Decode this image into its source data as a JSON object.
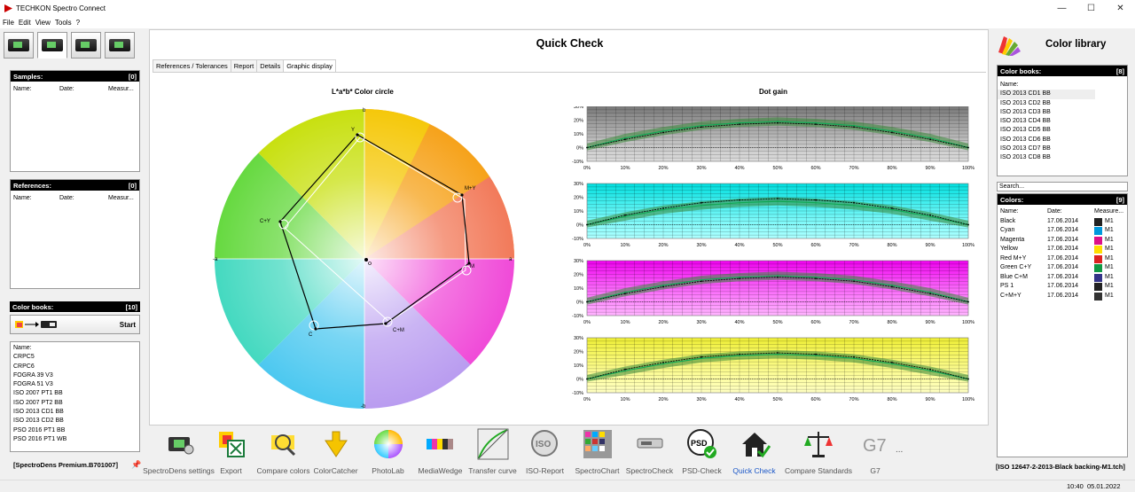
{
  "window": {
    "title": "TECHKON Spectro Connect",
    "min": "—",
    "max": "☐",
    "close": "✕"
  },
  "menu": [
    "File",
    "Edit",
    "View",
    "Tools",
    "?"
  ],
  "left": {
    "samples": {
      "title": "Samples:",
      "count": "[0]",
      "cols": [
        "Name:",
        "Date:",
        "Measur..."
      ]
    },
    "references": {
      "title": "References:",
      "count": "[0]",
      "cols": [
        "Name:",
        "Date:",
        "Measur..."
      ]
    },
    "colorbooks": {
      "title": "Color books:",
      "count": "[10]",
      "start": "Start",
      "col": "Name:",
      "items": [
        "CRPC5",
        "CRPC6",
        "FOGRA 39 V3",
        "FOGRA 51 V3",
        "ISO 2007 PT1 BB",
        "ISO 2007 PT2 BB",
        "ISO 2013 CD1 BB",
        "ISO 2013 CD2 BB",
        "PSO 2016 PT1 BB",
        "PSO 2016 PT1 WB"
      ]
    },
    "serial": "[SpectroDens Premium.B701007]",
    "pin": "📌"
  },
  "center": {
    "title": "Quick Check",
    "tabs": [
      "References / Tolerances",
      "Report",
      "Details",
      "Graphic display"
    ],
    "circle_title": "L*a*b* Color circle",
    "dot_title": "Dot gain",
    "axis_labels": {
      "top": "b",
      "bottom": "-b",
      "left": "-a",
      "right": "a"
    },
    "points": [
      "Y",
      "M+Y",
      "M",
      "C+M",
      "C",
      "C+Y"
    ]
  },
  "chart_data": [
    {
      "type": "line",
      "title": "Dot gain",
      "panel": "Black",
      "x": [
        0,
        10,
        20,
        30,
        40,
        50,
        60,
        70,
        80,
        90,
        100
      ],
      "xlabel": "",
      "ylabel": "",
      "ylim": [
        -10,
        30
      ],
      "yticks": [
        "30%",
        "20%",
        "10%",
        "0%",
        "-10%"
      ],
      "xticks": [
        "0%",
        "10%",
        "20%",
        "30%",
        "40%",
        "50%",
        "60%",
        "70%",
        "80%",
        "90%",
        "100%"
      ],
      "series": [
        {
          "values": [
            0,
            7,
            12,
            16,
            18,
            19,
            18,
            16,
            12,
            7,
            0
          ]
        },
        {
          "values": [
            0,
            6,
            11,
            15,
            17,
            18,
            17,
            15,
            11,
            6,
            0
          ]
        }
      ]
    },
    {
      "type": "line",
      "panel": "Cyan",
      "x": [
        0,
        10,
        20,
        30,
        40,
        50,
        60,
        70,
        80,
        90,
        100
      ],
      "ylim": [
        -10,
        30
      ],
      "series": [
        {
          "values": [
            0,
            6,
            11,
            14,
            16,
            17,
            16,
            14,
            11,
            6,
            0
          ]
        },
        {
          "values": [
            0,
            7,
            12,
            16,
            18,
            19,
            18,
            16,
            12,
            7,
            0
          ]
        }
      ]
    },
    {
      "type": "line",
      "panel": "Magenta",
      "x": [
        0,
        10,
        20,
        30,
        40,
        50,
        60,
        70,
        80,
        90,
        100
      ],
      "ylim": [
        -10,
        30
      ],
      "series": [
        {
          "values": [
            0,
            7,
            12,
            16,
            18,
            19,
            18,
            16,
            12,
            7,
            0
          ]
        },
        {
          "values": [
            0,
            6,
            11,
            15,
            17,
            18,
            17,
            15,
            11,
            6,
            0
          ]
        }
      ]
    },
    {
      "type": "line",
      "panel": "Yellow",
      "x": [
        0,
        10,
        20,
        30,
        40,
        50,
        60,
        70,
        80,
        90,
        100
      ],
      "ylim": [
        -10,
        30
      ],
      "series": [
        {
          "values": [
            0,
            6,
            11,
            15,
            17,
            18,
            17,
            15,
            11,
            6,
            0
          ]
        },
        {
          "values": [
            0,
            7,
            12,
            16,
            18,
            19,
            18,
            16,
            12,
            7,
            0
          ]
        }
      ]
    }
  ],
  "toolbar": [
    "SpectroDens settings",
    "Export",
    "Compare colors",
    "ColorCatcher",
    "PhotoLab",
    "MediaWedge",
    "Transfer curve",
    "ISO-Report",
    "SpectroChart",
    "SpectroCheck",
    "PSD-Check",
    "Quick Check",
    "Compare Standards",
    "G7"
  ],
  "toolbar_more": "...",
  "right": {
    "title": "Color library",
    "books": {
      "title": "Color books:",
      "count": "[8]",
      "col": "Name:",
      "items": [
        "ISO 2013 CD1 BB",
        "ISO 2013 CD2 BB",
        "ISO 2013 CD3 BB",
        "ISO 2013 CD4 BB",
        "ISO 2013 CD5 BB",
        "ISO 2013 CD6 BB",
        "ISO 2013 CD7 BB",
        "ISO 2013 CD8 BB"
      ]
    },
    "search_placeholder": "Search...",
    "colors": {
      "title": "Colors:",
      "count": "[9]",
      "cols": [
        "Name:",
        "Date:",
        "Measure..."
      ],
      "items": [
        {
          "name": "Black",
          "date": "17.06.2014",
          "m": "M1",
          "color": "#222222"
        },
        {
          "name": "Cyan",
          "date": "17.06.2014",
          "m": "M1",
          "color": "#0099dd"
        },
        {
          "name": "Magenta",
          "date": "17.06.2014",
          "m": "M1",
          "color": "#dd1188"
        },
        {
          "name": "Yellow",
          "date": "17.06.2014",
          "m": "M1",
          "color": "#ffdd00"
        },
        {
          "name": "Red M+Y",
          "date": "17.06.2014",
          "m": "M1",
          "color": "#dd2222"
        },
        {
          "name": "Green C+Y",
          "date": "17.06.2014",
          "m": "M1",
          "color": "#119944"
        },
        {
          "name": "Blue C+M",
          "date": "17.06.2014",
          "m": "M1",
          "color": "#333388"
        },
        {
          "name": "PS 1",
          "date": "17.06.2014",
          "m": "M1",
          "color": "#222222"
        },
        {
          "name": "C+M+Y",
          "date": "17.06.2014",
          "m": "M1",
          "color": "#333333"
        }
      ]
    },
    "status": "[ISO 12647-2-2013-Black backing-M1.tch]"
  },
  "statusbar": {
    "time": "10:40",
    "date": "05.01.2022"
  }
}
